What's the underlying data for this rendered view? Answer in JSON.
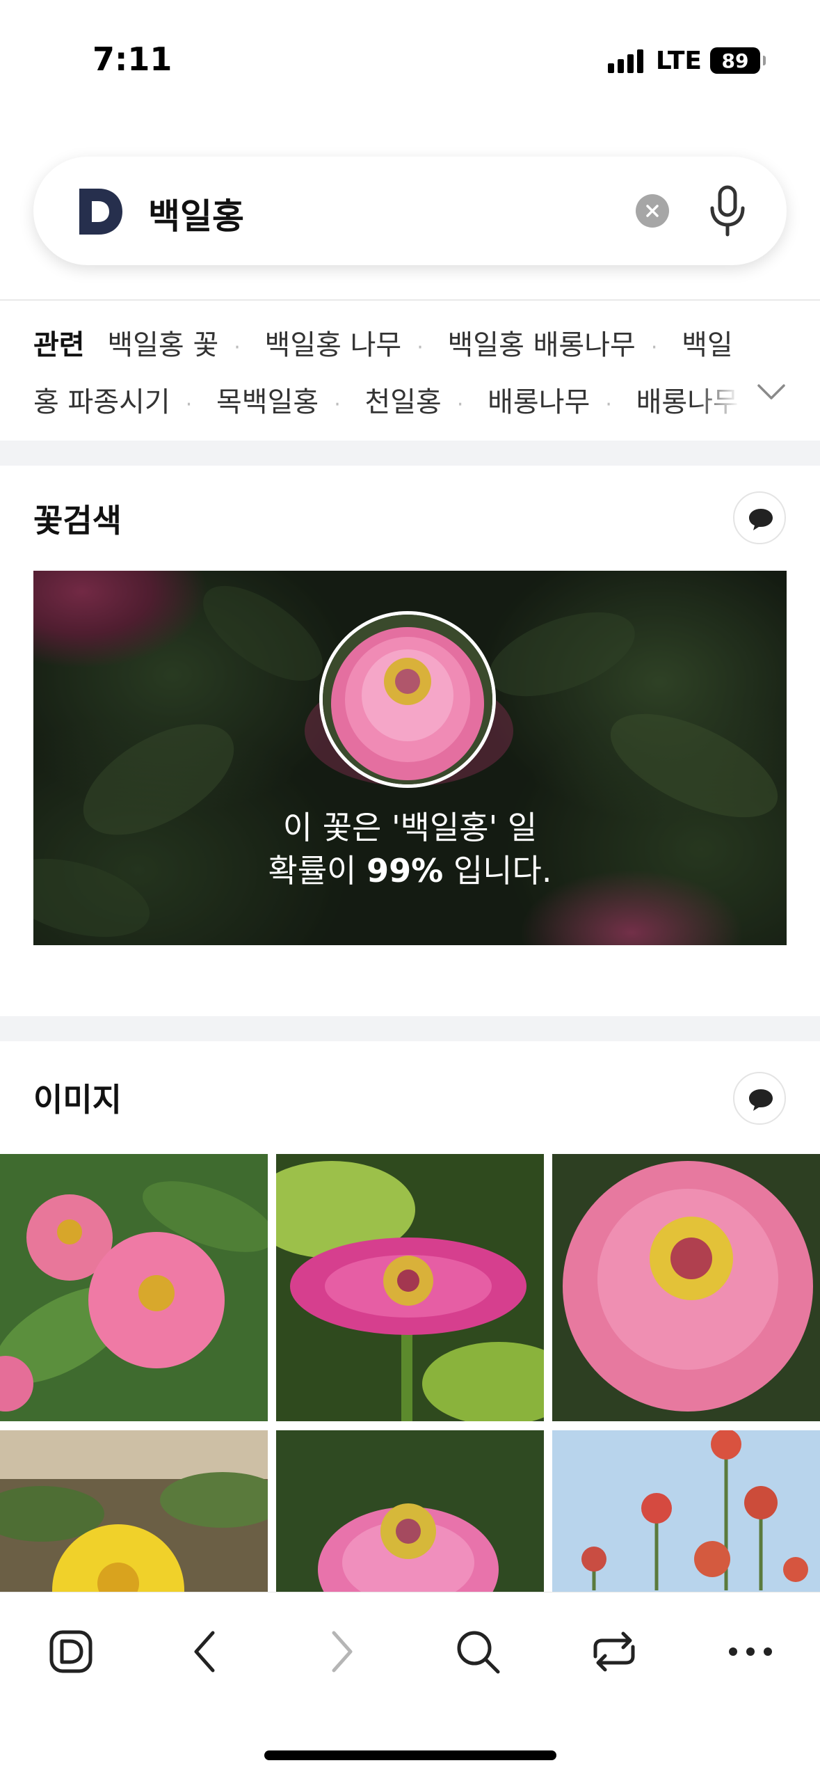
{
  "status_bar": {
    "time": "7:11",
    "network": "LTE",
    "battery": "89"
  },
  "search": {
    "query": "백일홍",
    "logo": "D"
  },
  "related": {
    "label": "관련",
    "items": [
      "백일홍 꽃",
      "백일홍 나무",
      "백일홍 배롱나무",
      "백일홍 파종시기",
      "목백일홍",
      "천일홍",
      "배롱나무",
      "배롱나무"
    ]
  },
  "flower_search": {
    "title": "꽃검색",
    "result_line1": "이 꽃은 '백일홍' 일",
    "result_prefix": "확률이 ",
    "result_percent": "99%",
    "result_suffix": " 입니다."
  },
  "images": {
    "title": "이미지"
  },
  "colors": {
    "accent": "#262f4d",
    "background_band": "#f2f3f5"
  },
  "toolbar": {
    "icons": [
      "daum-logo-icon",
      "back-icon",
      "forward-icon",
      "search-icon",
      "tabs-switch-icon",
      "more-icon"
    ]
  }
}
